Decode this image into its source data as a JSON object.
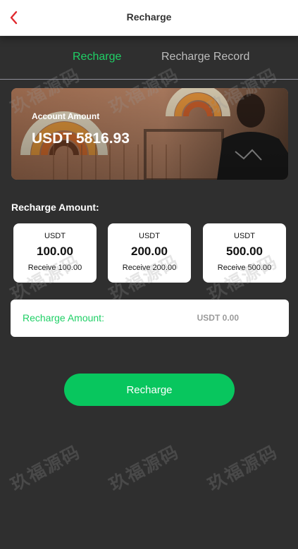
{
  "header": {
    "title": "Recharge",
    "back_icon": "chevron-left-icon",
    "back_icon_color": "#e0282d"
  },
  "tabs": [
    {
      "label": "Recharge",
      "active": true,
      "color": "#1fd066"
    },
    {
      "label": "Recharge Record",
      "active": false,
      "color": "#bdbdbd"
    }
  ],
  "account": {
    "label": "Account Amount",
    "value": "USDT 5816.93"
  },
  "amount_section": {
    "label": "Recharge Amount:"
  },
  "amount_options": [
    {
      "currency": "USDT",
      "amount": "100.00",
      "receive": "Receive 100.00"
    },
    {
      "currency": "USDT",
      "amount": "200.00",
      "receive": "Receive 200.00"
    },
    {
      "currency": "USDT",
      "amount": "500.00",
      "receive": "Receive 500.00"
    }
  ],
  "input": {
    "label": "Recharge Amount:",
    "placeholder": "USDT 0.00"
  },
  "submit": {
    "label": "Recharge",
    "color": "#08c65e"
  },
  "watermark": {
    "text": "玖福源码"
  }
}
